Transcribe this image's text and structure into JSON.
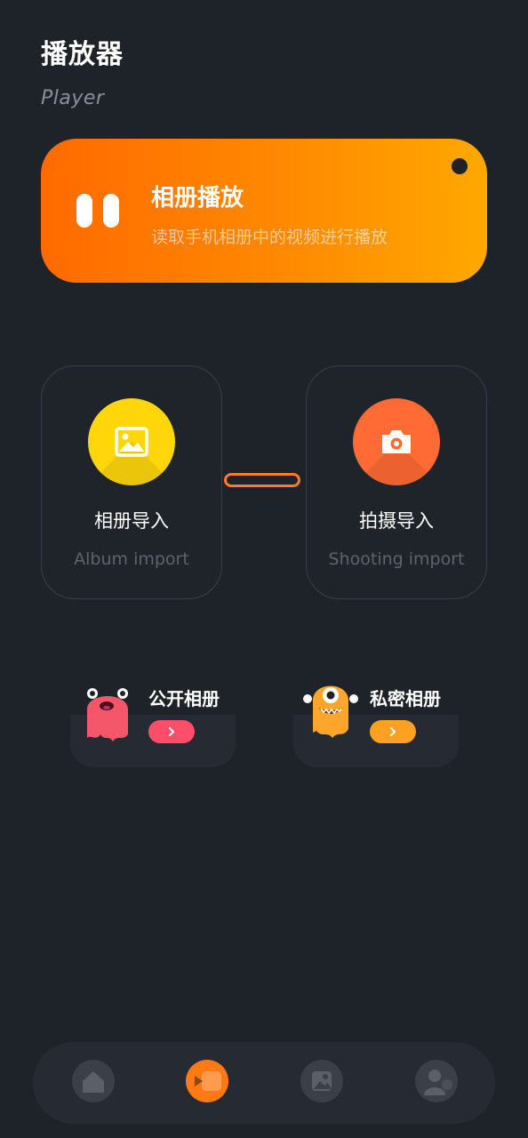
{
  "header": {
    "title": "播放器",
    "subtitle": "Player"
  },
  "banner": {
    "title": "相册播放",
    "description": "读取手机相册中的视频进行播放",
    "gradient_colors": [
      "#ff6a00",
      "#ffa800"
    ]
  },
  "import_cards": [
    {
      "label": "相册导入",
      "sublabel": "Album import",
      "icon": "image-icon",
      "color": "#ffd60a"
    },
    {
      "label": "拍摄导入",
      "sublabel": "Shooting import",
      "icon": "camera-icon",
      "color": "#ff6a35"
    }
  ],
  "albums": [
    {
      "label": "公开相册",
      "mascot": "pink-monster-icon",
      "arrow_color": "#ff4d6a"
    },
    {
      "label": "私密相册",
      "mascot": "orange-monster-icon",
      "arrow_color": "#ffa020"
    }
  ],
  "tabs": [
    {
      "name": "home",
      "icon": "home-icon",
      "active": false
    },
    {
      "name": "player",
      "icon": "video-camera-icon",
      "active": true
    },
    {
      "name": "gallery",
      "icon": "gallery-icon",
      "active": false
    },
    {
      "name": "profile",
      "icon": "user-icon",
      "active": false
    }
  ],
  "colors": {
    "background": "#1e2229",
    "accent": "#ff7a14"
  }
}
